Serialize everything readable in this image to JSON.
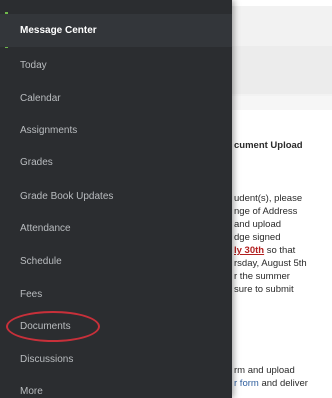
{
  "drawer": {
    "items": [
      {
        "label": "Message Center",
        "active": true
      },
      {
        "label": "Today"
      },
      {
        "label": "Calendar"
      },
      {
        "label": "Assignments"
      },
      {
        "label": "Grades"
      },
      {
        "label": "Grade Book Updates"
      },
      {
        "label": "Attendance"
      },
      {
        "label": "Schedule"
      },
      {
        "label": "Fees"
      },
      {
        "label": "Documents",
        "highlighted": true
      },
      {
        "label": "Discussions"
      },
      {
        "label": "More"
      }
    ]
  },
  "background": {
    "lines": [
      "cument Upload",
      "udent(s), please",
      "nge of Address",
      "and upload",
      "dge signed",
      "ly 30th",
      " so that",
      "rsday, August 5th",
      "r the summer",
      "sure to submit",
      "rm and upload",
      "r form",
      " and deliver"
    ]
  },
  "colors": {
    "drawer_bg": "#2b2d30",
    "accent": "#6fb84a",
    "highlight_circle": "#c8303a",
    "link_red": "#b21f1f",
    "link_blue": "#2f5f9e"
  }
}
